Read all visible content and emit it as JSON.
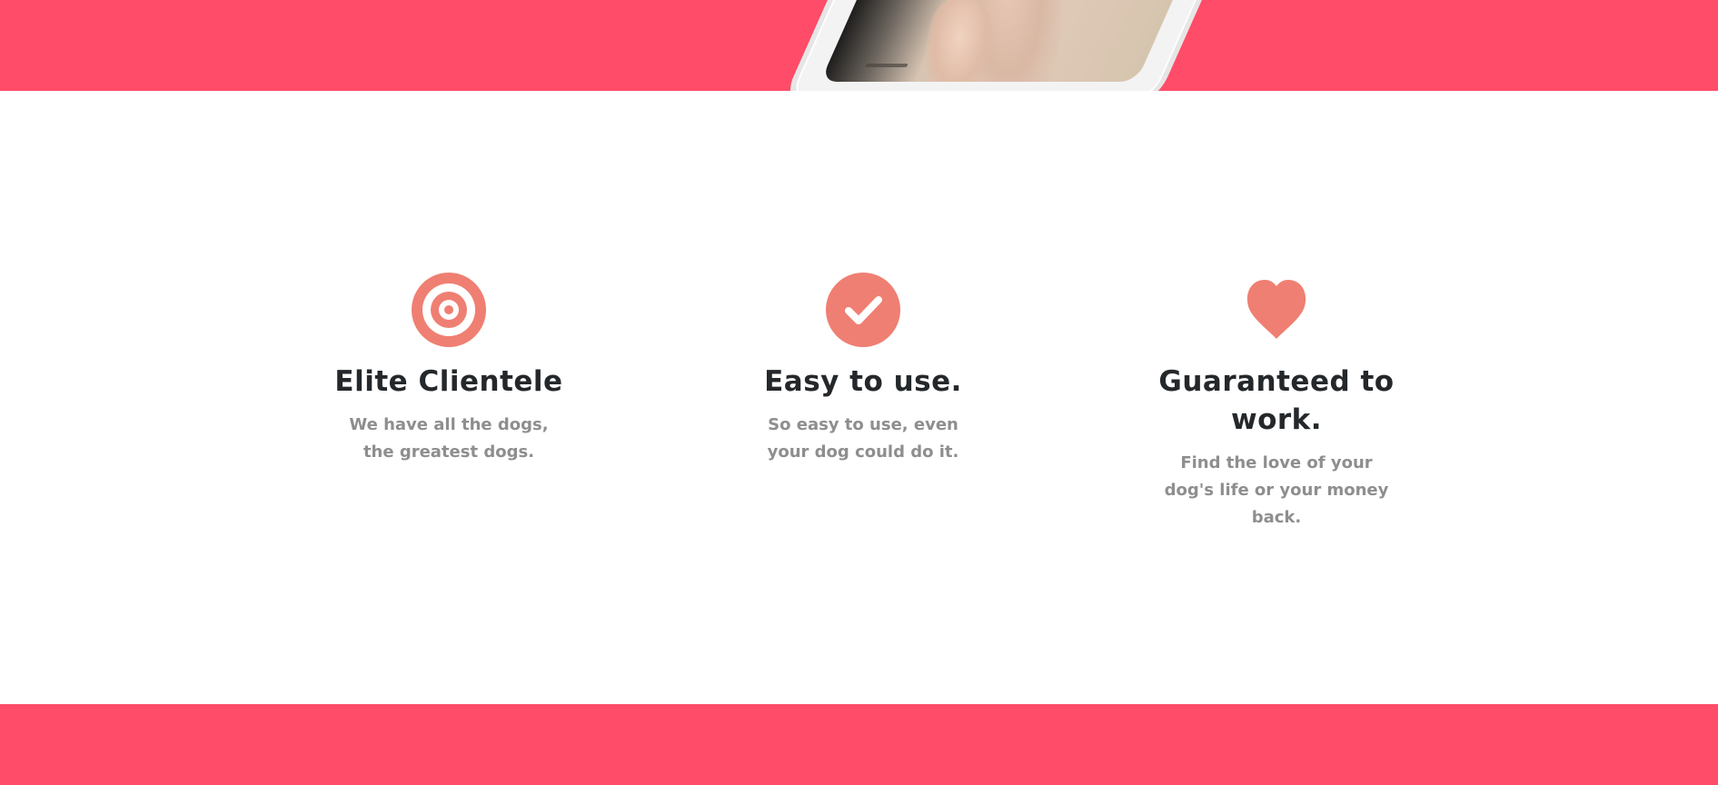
{
  "theme": {
    "band_color": "#ff4c68",
    "icon_color": "#ef7f72",
    "title_color": "#24282b",
    "text_color": "#8e8e8e"
  },
  "features": [
    {
      "icon": "target-icon",
      "title": "Elite Clientele",
      "text": "We have all the dogs, the greatest dogs."
    },
    {
      "icon": "check-circle-icon",
      "title": "Easy to use.",
      "text": "So easy to use, even your dog could do it."
    },
    {
      "icon": "heart-icon",
      "title": "Guaranteed to work.",
      "text": "Find the love of your dog's life or your money back."
    }
  ]
}
